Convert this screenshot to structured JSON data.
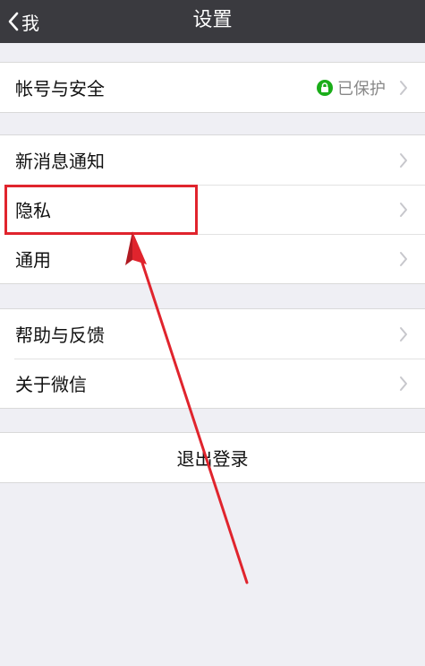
{
  "navbar": {
    "back_label": "我",
    "title": "设置"
  },
  "groups": [
    {
      "items": [
        {
          "label": "帐号与安全",
          "status": "已保护"
        }
      ]
    },
    {
      "items": [
        {
          "label": "新消息通知"
        },
        {
          "label": "隐私"
        },
        {
          "label": "通用"
        }
      ]
    },
    {
      "items": [
        {
          "label": "帮助与反馈"
        },
        {
          "label": "关于微信"
        }
      ]
    }
  ],
  "logout": {
    "label": "退出登录"
  },
  "colors": {
    "navbar_bg": "#3a3a3f",
    "page_bg": "#efeff4",
    "protect_green": "#1aad19",
    "annotation_red": "#e0242d"
  },
  "annotations": {
    "highlight_target": "隐私"
  }
}
